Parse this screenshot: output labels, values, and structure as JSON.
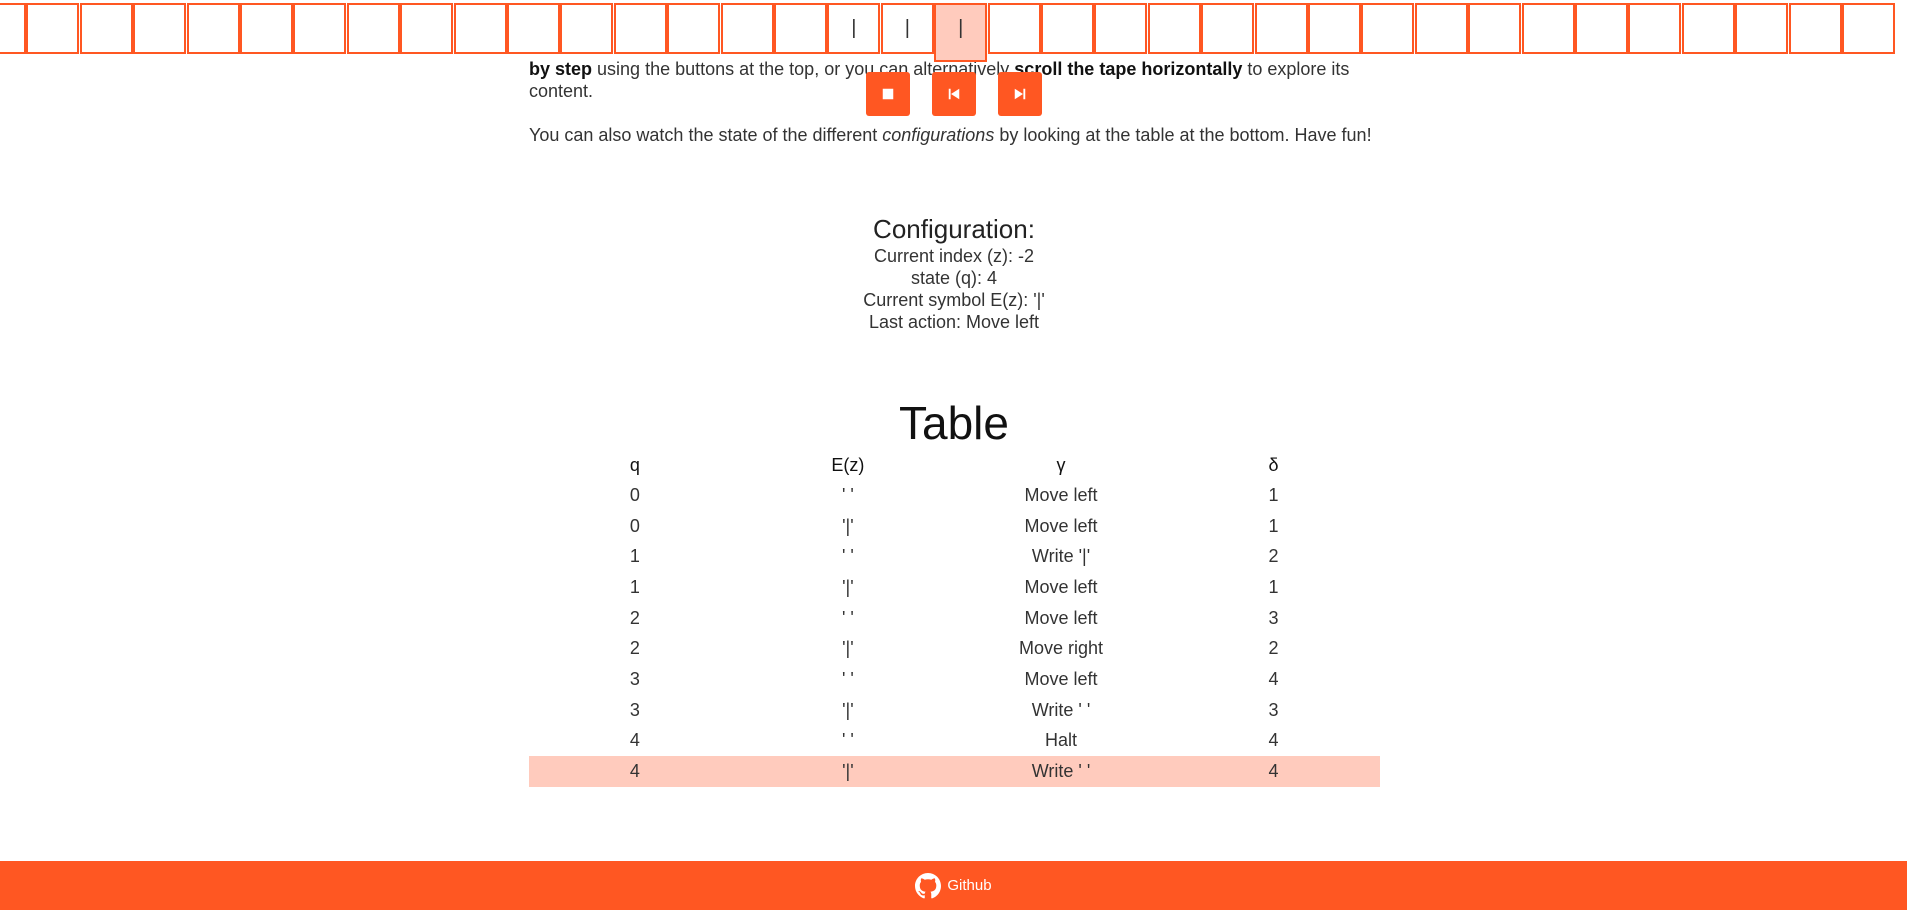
{
  "intro": {
    "p1": [
      {
        "text": "by step",
        "strong": true
      },
      {
        "text": " using the buttons at the top, or you can alternatively ",
        "strong": false
      },
      {
        "text": "scroll the tape horizontally",
        "strong": true
      },
      {
        "text": " to explore its content.",
        "strong": false
      }
    ],
    "p2_a": "You can also watch the state of the different ",
    "p2_em": "configurations",
    "p2_b": "  by looking at the table at the bottom. Have fun!"
  },
  "tape": {
    "cells": [
      "",
      "",
      "",
      "",
      "",
      "",
      "",
      "",
      "",
      "",
      "",
      "",
      "",
      "",
      "",
      "",
      "|",
      "|",
      "|",
      "",
      "",
      "",
      "",
      "",
      "",
      "",
      "",
      "",
      "",
      "",
      "",
      "",
      "",
      "",
      "",
      ""
    ],
    "active_index": 18
  },
  "controls": [
    {
      "name": "stop-button",
      "icon": "stop-icon"
    },
    {
      "name": "step-back-button",
      "icon": "skip-previous-icon"
    },
    {
      "name": "step-forward-button",
      "icon": "skip-next-icon"
    }
  ],
  "config": {
    "title": "Configuration:",
    "index": "Current index (z): -2",
    "state": "state (q): 4",
    "symbol": "Current symbol E(z): '|'",
    "last_action": "Last action: Move left"
  },
  "table": {
    "title": "Table",
    "headers": [
      "q",
      "E(z)",
      "γ",
      "δ"
    ],
    "rows": [
      [
        "0",
        "' '",
        "Move left",
        "1"
      ],
      [
        "0",
        "'|'",
        "Move left",
        "1"
      ],
      [
        "1",
        "' '",
        "Write '|'",
        "2"
      ],
      [
        "1",
        "'|'",
        "Move left",
        "1"
      ],
      [
        "2",
        "' '",
        "Move left",
        "3"
      ],
      [
        "2",
        "'|'",
        "Move right",
        "2"
      ],
      [
        "3",
        "' '",
        "Move left",
        "4"
      ],
      [
        "3",
        "'|'",
        "Write ' '",
        "3"
      ],
      [
        "4",
        "' '",
        "Halt",
        "4"
      ],
      [
        "4",
        "'|'",
        "Write ' '",
        "4"
      ]
    ],
    "highlight_row": 9
  },
  "footer": {
    "link_label": "Github",
    "icon": "github-icon"
  },
  "colors": {
    "accent": "#ff5722",
    "highlight": "#ffcbbd"
  }
}
